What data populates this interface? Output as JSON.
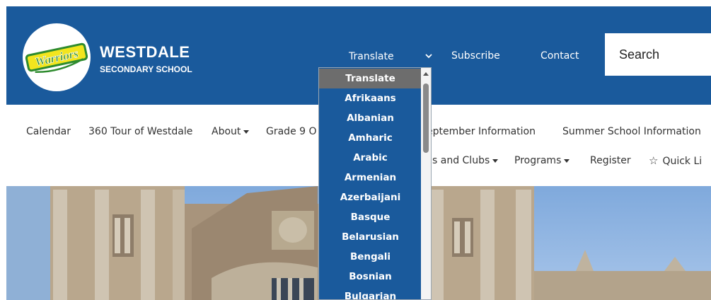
{
  "header": {
    "logo_text": "Warriors",
    "school_name": "WESTDALE",
    "school_subtitle": "SECONDARY SCHOOL",
    "translate_label": "Translate",
    "subscribe_label": "Subscribe",
    "contact_label": "Contact",
    "search_placeholder": "Search"
  },
  "nav": {
    "row1": [
      "Calendar",
      "360 Tour of Westdale",
      "About",
      "Grade 9 O",
      "eptember Information",
      "Summer School Information"
    ],
    "row2": [
      "s and Clubs",
      "Programs",
      "Register",
      "Quick Li"
    ]
  },
  "translate_dropdown": {
    "options": [
      "Translate",
      "Afrikaans",
      "Albanian",
      "Amharic",
      "Arabic",
      "Armenian",
      "Azerbaijani",
      "Basque",
      "Belarusian",
      "Bengali",
      "Bosnian",
      "Bulgarian"
    ],
    "selected": "Translate"
  },
  "colors": {
    "brand_blue": "#1a5a9c",
    "selected_option": "#6d6d6d",
    "logo_green": "#2e8b2e",
    "logo_yellow": "#f2e51e"
  }
}
